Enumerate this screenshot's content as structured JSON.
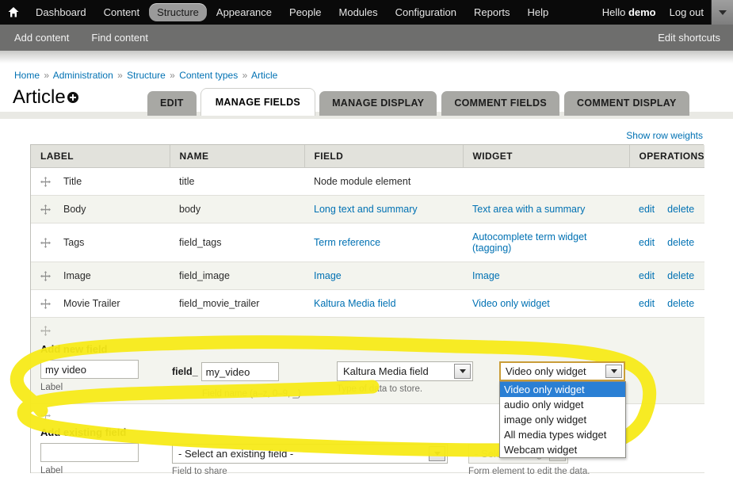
{
  "toolbar": {
    "home_icon": "home-icon",
    "items": [
      {
        "label": "Dashboard",
        "active": false
      },
      {
        "label": "Content",
        "active": false
      },
      {
        "label": "Structure",
        "active": true
      },
      {
        "label": "Appearance",
        "active": false
      },
      {
        "label": "People",
        "active": false
      },
      {
        "label": "Modules",
        "active": false
      },
      {
        "label": "Configuration",
        "active": false
      },
      {
        "label": "Reports",
        "active": false
      },
      {
        "label": "Help",
        "active": false
      }
    ],
    "greeting_prefix": "Hello ",
    "username": "demo",
    "logout_label": "Log out",
    "dropdown_icon": "chevron-down-icon"
  },
  "shortcut_bar": {
    "items": [
      "Add content",
      "Find content"
    ],
    "edit_label": "Edit shortcuts"
  },
  "breadcrumb": {
    "separator": "»",
    "items": [
      "Home",
      "Administration",
      "Structure",
      "Content types",
      "Article"
    ]
  },
  "page": {
    "title": "Article",
    "title_badge_icon": "add-circle-icon",
    "show_row_weights": "Show row weights"
  },
  "tabs": [
    {
      "label": "EDIT",
      "active": false
    },
    {
      "label": "MANAGE FIELDS",
      "active": true
    },
    {
      "label": "MANAGE DISPLAY",
      "active": false
    },
    {
      "label": "COMMENT FIELDS",
      "active": false
    },
    {
      "label": "COMMENT DISPLAY",
      "active": false
    }
  ],
  "table": {
    "headers": [
      "LABEL",
      "NAME",
      "FIELD",
      "WIDGET",
      "OPERATIONS"
    ],
    "rows": [
      {
        "label": "Title",
        "name": "title",
        "field": "Node module element",
        "field_link": false,
        "widget": "",
        "widget_link": false,
        "widget2": "",
        "ops": []
      },
      {
        "label": "Body",
        "name": "body",
        "field": "Long text and summary",
        "field_link": true,
        "widget": "Text area with a summary",
        "widget_link": true,
        "widget2": "",
        "ops": [
          "edit",
          "delete"
        ]
      },
      {
        "label": "Tags",
        "name": "field_tags",
        "field": "Term reference",
        "field_link": true,
        "widget": "Autocomplete term widget",
        "widget_link": true,
        "widget2": "(tagging)",
        "ops": [
          "edit",
          "delete"
        ]
      },
      {
        "label": "Image",
        "name": "field_image",
        "field": "Image",
        "field_link": true,
        "widget": "Image",
        "widget_link": true,
        "widget2": "",
        "ops": [
          "edit",
          "delete"
        ]
      },
      {
        "label": "Movie Trailer",
        "name": "field_movie_trailer",
        "field": "Kaltura Media field",
        "field_link": true,
        "widget": "Video only widget",
        "widget_link": true,
        "widget2": "",
        "ops": [
          "edit",
          "delete"
        ]
      }
    ]
  },
  "add_new_field": {
    "heading": "Add new field",
    "label_value": "my video",
    "label_caption": "Label",
    "machine_prefix": "field_",
    "machine_value": "my_video",
    "machine_hint": "Field name (a–z, 0–9, _)",
    "type_value": "Kaltura Media field",
    "type_hint": "Type of data to store.",
    "widget_value": "Video only widget",
    "widget_options": [
      {
        "label": "Video only widget",
        "selected": true
      },
      {
        "label": "audio only widget",
        "selected": false
      },
      {
        "label": "image only widget",
        "selected": false
      },
      {
        "label": "All media types widget",
        "selected": false
      },
      {
        "label": "Webcam widget",
        "selected": false
      }
    ]
  },
  "add_existing_field": {
    "heading": "Add existing field",
    "label_value": "",
    "label_caption": "Label",
    "select_field_value": "- Select an existing field -",
    "select_field_hint": "Field to share",
    "select_widget_value": "- Select a widget -",
    "select_widget_hint": "Form element to edit the data."
  },
  "annotation": {
    "highlight_color": "#f7ea18",
    "kind": "handdrawn-yellow-highlighter-loop"
  }
}
